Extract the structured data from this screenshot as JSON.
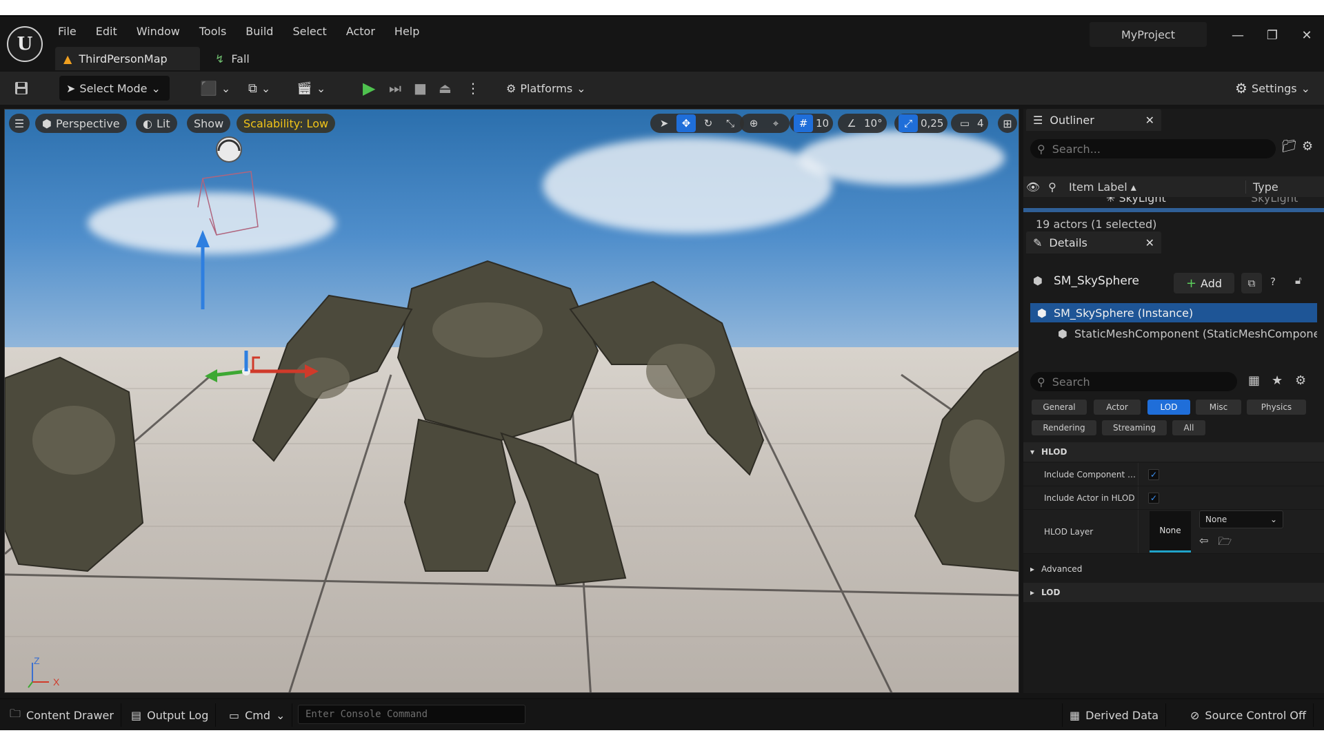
{
  "window": {
    "project": "MyProject",
    "menu": [
      "File",
      "Edit",
      "Window",
      "Tools",
      "Build",
      "Select",
      "Actor",
      "Help"
    ],
    "doc_tabs": [
      {
        "label": "ThirdPersonMap"
      },
      {
        "label": "Fall"
      }
    ]
  },
  "toolbar": {
    "select_mode": "Select Mode",
    "platforms": "Platforms",
    "settings": "Settings"
  },
  "viewport": {
    "perspective": "Perspective",
    "lit": "Lit",
    "show": "Show",
    "scalability": "Scalability: Low",
    "grid_snap": "10",
    "rotation_snap": "10°",
    "scale_snap": "0,25",
    "camera_speed": "4",
    "axis_z": "Z",
    "axis_x": "X"
  },
  "outliner": {
    "title": "Outliner",
    "search_placeholder": "Search...",
    "col_label": "Item Label",
    "col_type": "Type",
    "partial_row_label": "SkyLight",
    "partial_row_type": "SkyLight",
    "status": "19 actors (1 selected)"
  },
  "details": {
    "title": "Details",
    "object_name": "SM_SkySphere",
    "add_label": "Add",
    "components": [
      {
        "label": "SM_SkySphere (Instance)"
      },
      {
        "label": "StaticMeshComponent (StaticMeshCompone"
      }
    ],
    "search_placeholder": "Search",
    "filters_row1": [
      "General",
      "Actor",
      "LOD",
      "Misc",
      "Physics"
    ],
    "filters_row2": [
      "Rendering",
      "Streaming",
      "All"
    ],
    "active_filter": "LOD",
    "sections": {
      "hlod": "HLOD",
      "advanced": "Advanced",
      "lod": "LOD"
    },
    "props": {
      "include_component": "Include Component in...",
      "include_actor": "Include Actor in HLOD",
      "hlod_layer": "HLOD Layer",
      "hlod_layer_thumb": "None",
      "hlod_layer_value": "None"
    }
  },
  "statusbar": {
    "content_drawer": "Content Drawer",
    "output_log": "Output Log",
    "cmd": "Cmd",
    "console_placeholder": "Enter Console Command",
    "derived_data": "Derived Data",
    "source_control": "Source Control Off"
  },
  "colors": {
    "accent": "#1f6ed9",
    "play": "#4fc24f",
    "scalability": "#f2c418"
  }
}
